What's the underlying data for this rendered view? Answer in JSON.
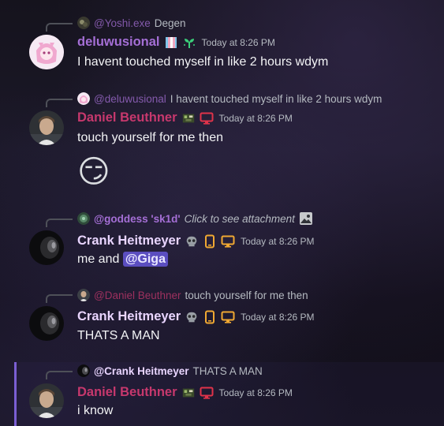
{
  "colors": {
    "purple_name": "#a56fd6",
    "pink_name": "#c7386d",
    "crank_name": "#e9d5ff",
    "mention_bg": "#5b4ec0",
    "timestamp": "#b5bac1",
    "orange_icon": "#f0a832",
    "red_icon": "#e0334a"
  },
  "messages": [
    {
      "reply": {
        "name": "@Yoshi.exe",
        "text": "Degen"
      },
      "author": "deluwusional",
      "timestamp": "Today at 8:26 PM",
      "text": "I havent touched myself in like 2 hours wdym",
      "avatar_icon": "anime-avatar-icon"
    },
    {
      "reply": {
        "name": "@deluwusional",
        "text": "I havent touched myself in like 2 hours wdym"
      },
      "author": "Daniel Beuthner",
      "timestamp": "Today at 8:26 PM",
      "text": "touch yourself for me then",
      "emoji": "😏",
      "avatar_icon": "person-avatar-icon"
    },
    {
      "reply": {
        "name": "@goddess 'sk1d'",
        "text": "Click to see attachment"
      },
      "author": "Crank Heitmeyer",
      "timestamp": "Today at 8:26 PM",
      "text_prefix": "me and ",
      "mention": "@Giga",
      "avatar_icon": "dark-avatar-icon"
    },
    {
      "reply": {
        "name": "@Daniel Beuthner",
        "text": "touch yourself for me then"
      },
      "author": "Crank Heitmeyer",
      "timestamp": "Today at 8:26 PM",
      "text": "THATS A MAN",
      "avatar_icon": "dark-avatar-icon"
    },
    {
      "reply": {
        "name": "@Crank Heitmeyer",
        "text": "THATS A MAN"
      },
      "author": "Daniel Beuthner",
      "timestamp": "Today at 8:26 PM",
      "text": "i know",
      "avatar_icon": "person-avatar-icon"
    }
  ]
}
